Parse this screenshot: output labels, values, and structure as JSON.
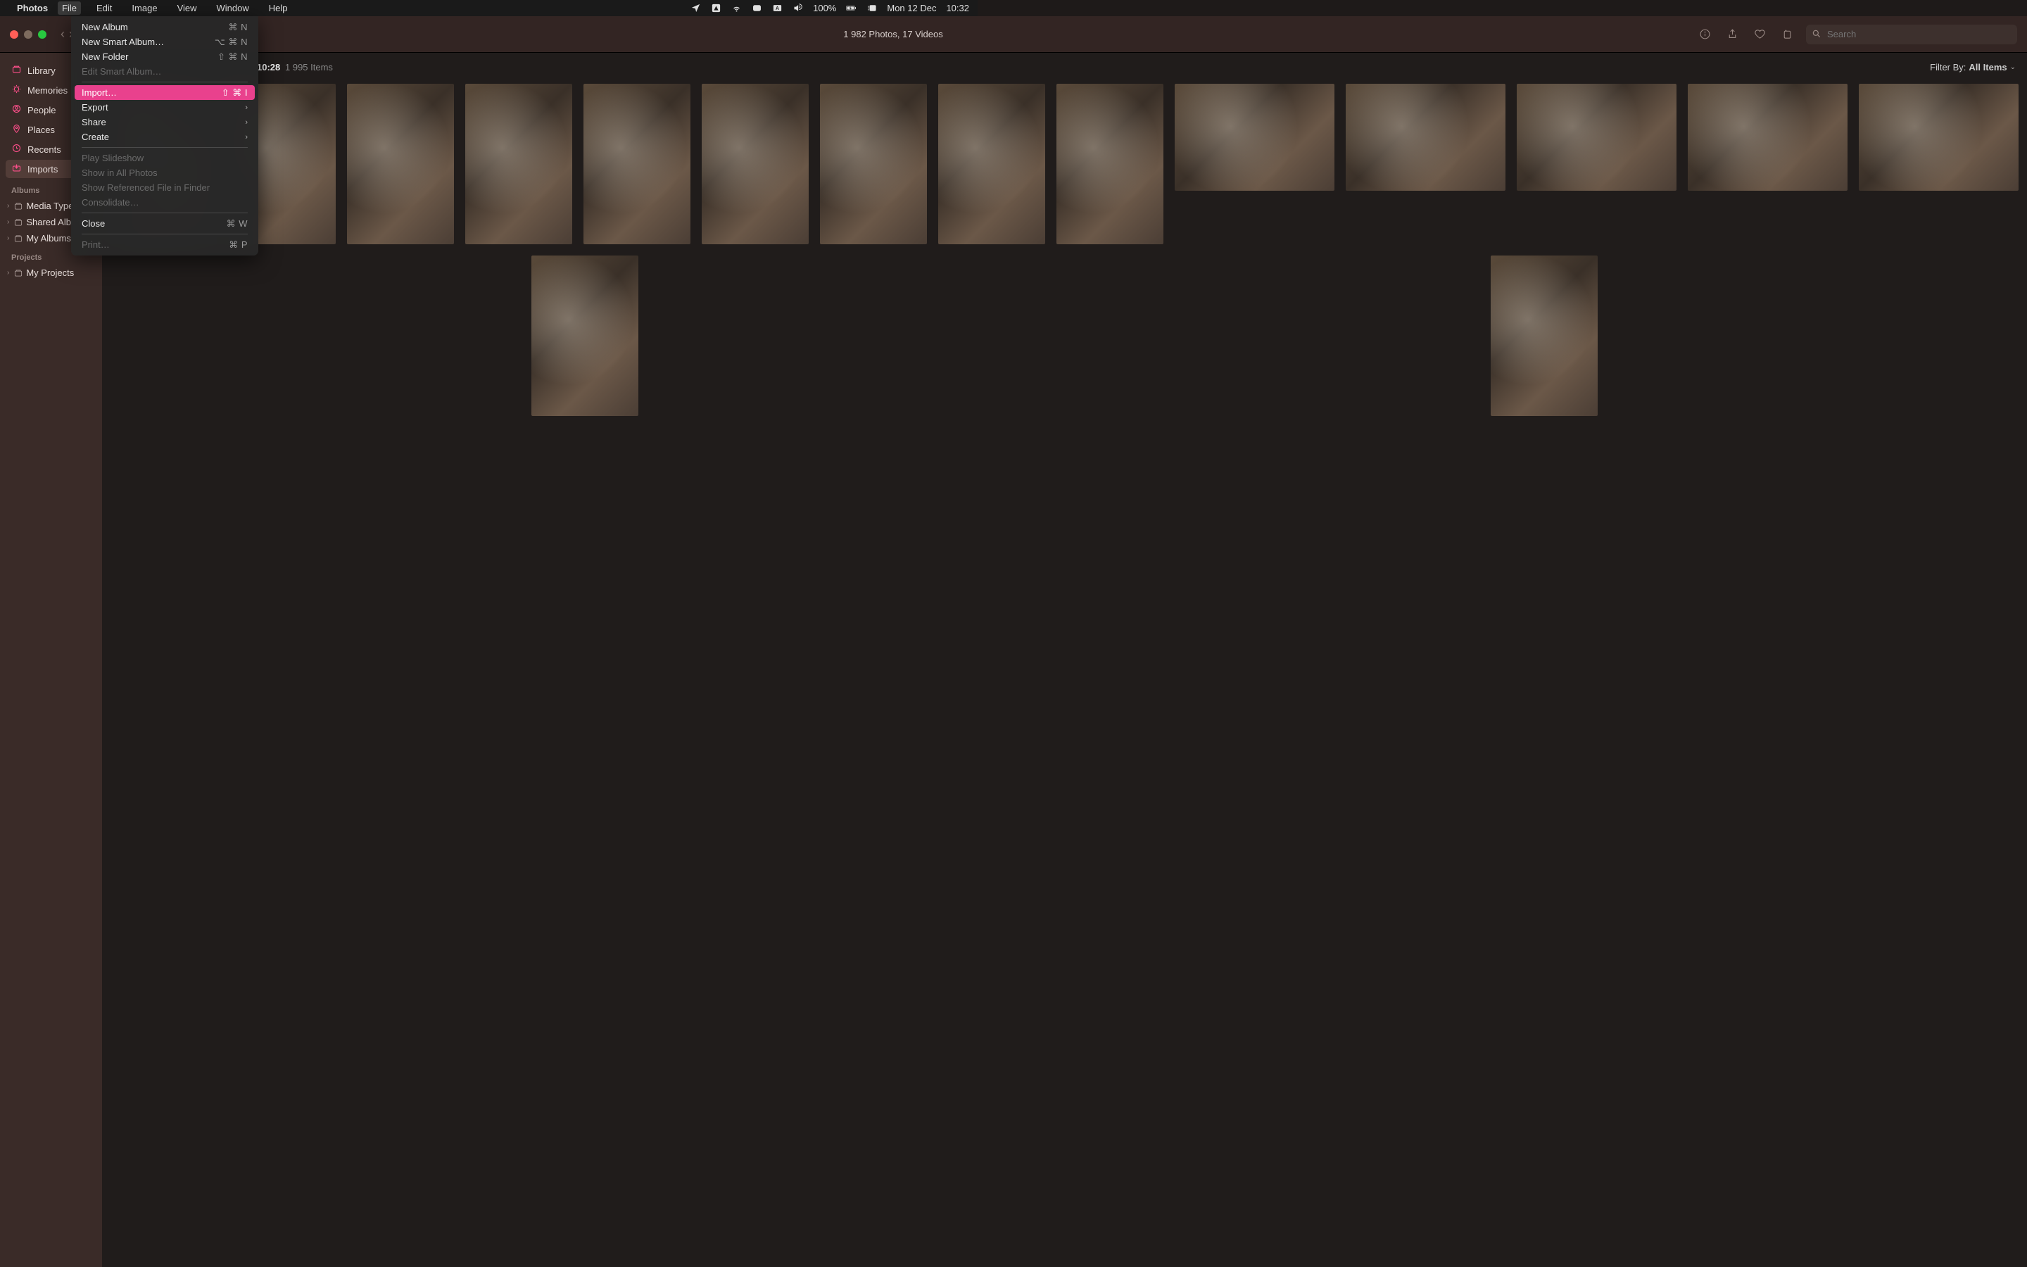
{
  "menubar": {
    "app": "Photos",
    "items": [
      "File",
      "Edit",
      "Image",
      "View",
      "Window",
      "Help"
    ],
    "open_index": 0,
    "battery": "100%",
    "date": "Mon 12 Dec",
    "time": "10:32"
  },
  "dropdown": {
    "groups": [
      [
        {
          "label": "New Album",
          "shortcut": "⌘ N",
          "enabled": true
        },
        {
          "label": "New Smart Album…",
          "shortcut": "⌥ ⌘ N",
          "enabled": true
        },
        {
          "label": "New Folder",
          "shortcut": "⇧ ⌘ N",
          "enabled": true
        },
        {
          "label": "Edit Smart Album…",
          "shortcut": "",
          "enabled": false
        }
      ],
      [
        {
          "label": "Import…",
          "shortcut": "⇧ ⌘ I",
          "enabled": true,
          "highlight": true
        },
        {
          "label": "Export",
          "shortcut": "",
          "enabled": true,
          "submenu": true
        },
        {
          "label": "Share",
          "shortcut": "",
          "enabled": true,
          "submenu": true
        },
        {
          "label": "Create",
          "shortcut": "",
          "enabled": true,
          "submenu": true
        }
      ],
      [
        {
          "label": "Play Slideshow",
          "shortcut": "",
          "enabled": false
        },
        {
          "label": "Show in All Photos",
          "shortcut": "",
          "enabled": false
        },
        {
          "label": "Show Referenced File in Finder",
          "shortcut": "",
          "enabled": false
        },
        {
          "label": "Consolidate…",
          "shortcut": "",
          "enabled": false
        }
      ],
      [
        {
          "label": "Close",
          "shortcut": "⌘ W",
          "enabled": true
        }
      ],
      [
        {
          "label": "Print…",
          "shortcut": "⌘ P",
          "enabled": false
        }
      ]
    ]
  },
  "window": {
    "title": "1 982 Photos, 17 Videos",
    "search_placeholder": "Search"
  },
  "sidebar": {
    "primary": [
      {
        "label": "Library",
        "icon": "library"
      },
      {
        "label": "Memories",
        "icon": "memories"
      },
      {
        "label": "People",
        "icon": "people"
      },
      {
        "label": "Places",
        "icon": "places"
      },
      {
        "label": "Recents",
        "icon": "recents"
      },
      {
        "label": "Imports",
        "icon": "imports",
        "selected": true
      }
    ],
    "albums_header": "Albums",
    "albums": [
      {
        "label": "Media Types"
      },
      {
        "label": "Shared Albums"
      },
      {
        "label": "My Albums"
      }
    ],
    "projects_header": "Projects",
    "projects": [
      {
        "label": "My Projects"
      }
    ]
  },
  "content": {
    "time_label": "10:28",
    "count_label": "1 995 Items",
    "filter_prefix": "Filter By:",
    "filter_value": "All Items",
    "thumbs": [
      {
        "shape": "portrait"
      },
      {
        "shape": "portrait"
      },
      {
        "shape": "portrait"
      },
      {
        "shape": "portrait"
      },
      {
        "shape": "portrait"
      },
      {
        "shape": "portrait"
      },
      {
        "shape": "portrait"
      },
      {
        "shape": "portrait"
      },
      {
        "shape": "portrait"
      },
      {
        "shape": "landscape"
      },
      {
        "shape": "landscape"
      },
      {
        "shape": "landscape"
      },
      {
        "shape": "landscape"
      },
      {
        "shape": "landscape"
      },
      {
        "shape": "portrait"
      },
      {
        "shape": "portrait"
      }
    ]
  }
}
